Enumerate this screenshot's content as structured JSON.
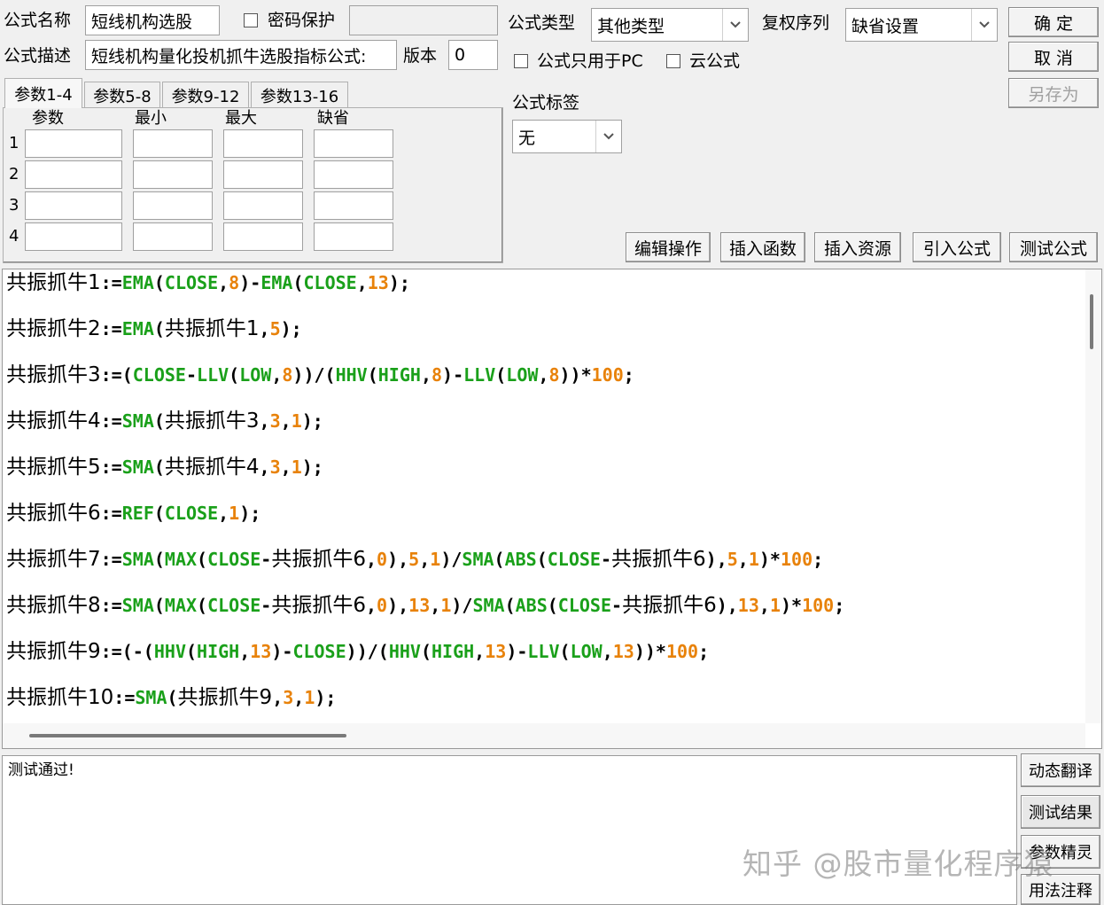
{
  "form": {
    "name_label": "公式名称",
    "name_value": "短线机构选股",
    "password_label": "密码保护",
    "desc_label": "公式描述",
    "desc_value": "短线机构量化投机抓牛选股指标公式:",
    "version_label": "版本",
    "version_value": "0",
    "type_label": "公式类型",
    "type_value": "其他类型",
    "restore_label": "复权序列",
    "restore_value": "缺省设置",
    "pc_only_label": "公式只用于PC",
    "cloud_label": "云公式",
    "tag_label": "公式标签",
    "tag_value": "无"
  },
  "buttons": {
    "ok": "确  定",
    "cancel": "取  消",
    "save_as": "另存为",
    "edit_ops": "编辑操作",
    "insert_func": "插入函数",
    "insert_res": "插入资源",
    "import_formula": "引入公式",
    "test_formula": "测试公式"
  },
  "params": {
    "tabs": [
      "参数1-4",
      "参数5-8",
      "参数9-12",
      "参数13-16"
    ],
    "headers": [
      "参数",
      "最小",
      "最大",
      "缺省"
    ],
    "rows": [
      "1",
      "2",
      "3",
      "4"
    ]
  },
  "code": [
    [
      [
        "cn",
        "共振抓牛1"
      ],
      [
        "pl",
        ":="
      ],
      [
        "kw",
        "EMA"
      ],
      [
        "pl",
        "("
      ],
      [
        "kw",
        "CLOSE"
      ],
      [
        "pl",
        ","
      ],
      [
        "num",
        "8"
      ],
      [
        "pl",
        ")-"
      ],
      [
        "kw",
        "EMA"
      ],
      [
        "pl",
        "("
      ],
      [
        "kw",
        "CLOSE"
      ],
      [
        "pl",
        ","
      ],
      [
        "num",
        "13"
      ],
      [
        "pl",
        ");"
      ]
    ],
    [
      [
        "cn",
        "共振抓牛2"
      ],
      [
        "pl",
        ":="
      ],
      [
        "kw",
        "EMA"
      ],
      [
        "pl",
        "("
      ],
      [
        "cn",
        "共振抓牛1"
      ],
      [
        "pl",
        ","
      ],
      [
        "num",
        "5"
      ],
      [
        "pl",
        ");"
      ]
    ],
    [
      [
        "cn",
        "共振抓牛3"
      ],
      [
        "pl",
        ":=("
      ],
      [
        "kw",
        "CLOSE"
      ],
      [
        "pl",
        "-"
      ],
      [
        "kw",
        "LLV"
      ],
      [
        "pl",
        "("
      ],
      [
        "kw",
        "LOW"
      ],
      [
        "pl",
        ","
      ],
      [
        "num",
        "8"
      ],
      [
        "pl",
        "))/("
      ],
      [
        "kw",
        "HHV"
      ],
      [
        "pl",
        "("
      ],
      [
        "kw",
        "HIGH"
      ],
      [
        "pl",
        ","
      ],
      [
        "num",
        "8"
      ],
      [
        "pl",
        ")-"
      ],
      [
        "kw",
        "LLV"
      ],
      [
        "pl",
        "("
      ],
      [
        "kw",
        "LOW"
      ],
      [
        "pl",
        ","
      ],
      [
        "num",
        "8"
      ],
      [
        "pl",
        "))*"
      ],
      [
        "num",
        "100"
      ],
      [
        "pl",
        ";"
      ]
    ],
    [
      [
        "cn",
        "共振抓牛4"
      ],
      [
        "pl",
        ":="
      ],
      [
        "kw",
        "SMA"
      ],
      [
        "pl",
        "("
      ],
      [
        "cn",
        "共振抓牛3"
      ],
      [
        "pl",
        ","
      ],
      [
        "num",
        "3"
      ],
      [
        "pl",
        ","
      ],
      [
        "num",
        "1"
      ],
      [
        "pl",
        ");"
      ]
    ],
    [
      [
        "cn",
        "共振抓牛5"
      ],
      [
        "pl",
        ":="
      ],
      [
        "kw",
        "SMA"
      ],
      [
        "pl",
        "("
      ],
      [
        "cn",
        "共振抓牛4"
      ],
      [
        "pl",
        ","
      ],
      [
        "num",
        "3"
      ],
      [
        "pl",
        ","
      ],
      [
        "num",
        "1"
      ],
      [
        "pl",
        ");"
      ]
    ],
    [
      [
        "cn",
        "共振抓牛6"
      ],
      [
        "pl",
        ":="
      ],
      [
        "kw",
        "REF"
      ],
      [
        "pl",
        "("
      ],
      [
        "kw",
        "CLOSE"
      ],
      [
        "pl",
        ","
      ],
      [
        "num",
        "1"
      ],
      [
        "pl",
        ");"
      ]
    ],
    [
      [
        "cn",
        "共振抓牛7"
      ],
      [
        "pl",
        ":="
      ],
      [
        "kw",
        "SMA"
      ],
      [
        "pl",
        "("
      ],
      [
        "kw",
        "MAX"
      ],
      [
        "pl",
        "("
      ],
      [
        "kw",
        "CLOSE"
      ],
      [
        "pl",
        "-"
      ],
      [
        "cn",
        "共振抓牛6"
      ],
      [
        "pl",
        ","
      ],
      [
        "num",
        "0"
      ],
      [
        "pl",
        "),"
      ],
      [
        "num",
        "5"
      ],
      [
        "pl",
        ","
      ],
      [
        "num",
        "1"
      ],
      [
        "pl",
        ")/"
      ],
      [
        "kw",
        "SMA"
      ],
      [
        "pl",
        "("
      ],
      [
        "kw",
        "ABS"
      ],
      [
        "pl",
        "("
      ],
      [
        "kw",
        "CLOSE"
      ],
      [
        "pl",
        "-"
      ],
      [
        "cn",
        "共振抓牛6"
      ],
      [
        "pl",
        "),"
      ],
      [
        "num",
        "5"
      ],
      [
        "pl",
        ","
      ],
      [
        "num",
        "1"
      ],
      [
        "pl",
        ")*"
      ],
      [
        "num",
        "100"
      ],
      [
        "pl",
        ";"
      ]
    ],
    [
      [
        "cn",
        "共振抓牛8"
      ],
      [
        "pl",
        ":="
      ],
      [
        "kw",
        "SMA"
      ],
      [
        "pl",
        "("
      ],
      [
        "kw",
        "MAX"
      ],
      [
        "pl",
        "("
      ],
      [
        "kw",
        "CLOSE"
      ],
      [
        "pl",
        "-"
      ],
      [
        "cn",
        "共振抓牛6"
      ],
      [
        "pl",
        ","
      ],
      [
        "num",
        "0"
      ],
      [
        "pl",
        "),"
      ],
      [
        "num",
        "13"
      ],
      [
        "pl",
        ","
      ],
      [
        "num",
        "1"
      ],
      [
        "pl",
        ")/"
      ],
      [
        "kw",
        "SMA"
      ],
      [
        "pl",
        "("
      ],
      [
        "kw",
        "ABS"
      ],
      [
        "pl",
        "("
      ],
      [
        "kw",
        "CLOSE"
      ],
      [
        "pl",
        "-"
      ],
      [
        "cn",
        "共振抓牛6"
      ],
      [
        "pl",
        "),"
      ],
      [
        "num",
        "13"
      ],
      [
        "pl",
        ","
      ],
      [
        "num",
        "1"
      ],
      [
        "pl",
        ")*"
      ],
      [
        "num",
        "100"
      ],
      [
        "pl",
        ";"
      ]
    ],
    [
      [
        "cn",
        "共振抓牛9"
      ],
      [
        "pl",
        ":=(-("
      ],
      [
        "kw",
        "HHV"
      ],
      [
        "pl",
        "("
      ],
      [
        "kw",
        "HIGH"
      ],
      [
        "pl",
        ","
      ],
      [
        "num",
        "13"
      ],
      [
        "pl",
        ")-"
      ],
      [
        "kw",
        "CLOSE"
      ],
      [
        "pl",
        "))/("
      ],
      [
        "kw",
        "HHV"
      ],
      [
        "pl",
        "("
      ],
      [
        "kw",
        "HIGH"
      ],
      [
        "pl",
        ","
      ],
      [
        "num",
        "13"
      ],
      [
        "pl",
        ")-"
      ],
      [
        "kw",
        "LLV"
      ],
      [
        "pl",
        "("
      ],
      [
        "kw",
        "LOW"
      ],
      [
        "pl",
        ","
      ],
      [
        "num",
        "13"
      ],
      [
        "pl",
        "))*"
      ],
      [
        "num",
        "100"
      ],
      [
        "pl",
        ";"
      ]
    ],
    [
      [
        "cn",
        "共振抓牛10"
      ],
      [
        "pl",
        ":="
      ],
      [
        "kw",
        "SMA"
      ],
      [
        "pl",
        "("
      ],
      [
        "cn",
        "共振抓牛9"
      ],
      [
        "pl",
        ","
      ],
      [
        "num",
        "3"
      ],
      [
        "pl",
        ","
      ],
      [
        "num",
        "1"
      ],
      [
        "pl",
        ");"
      ]
    ]
  ],
  "output": {
    "text": "测试通过!"
  },
  "side_buttons": [
    "动态翻译",
    "测试结果",
    "参数精灵",
    "用法注释"
  ],
  "watermark": "知乎 @股市量化程序猿",
  "colors": {
    "keyword": "#1aa01a",
    "number": "#e8820a"
  }
}
